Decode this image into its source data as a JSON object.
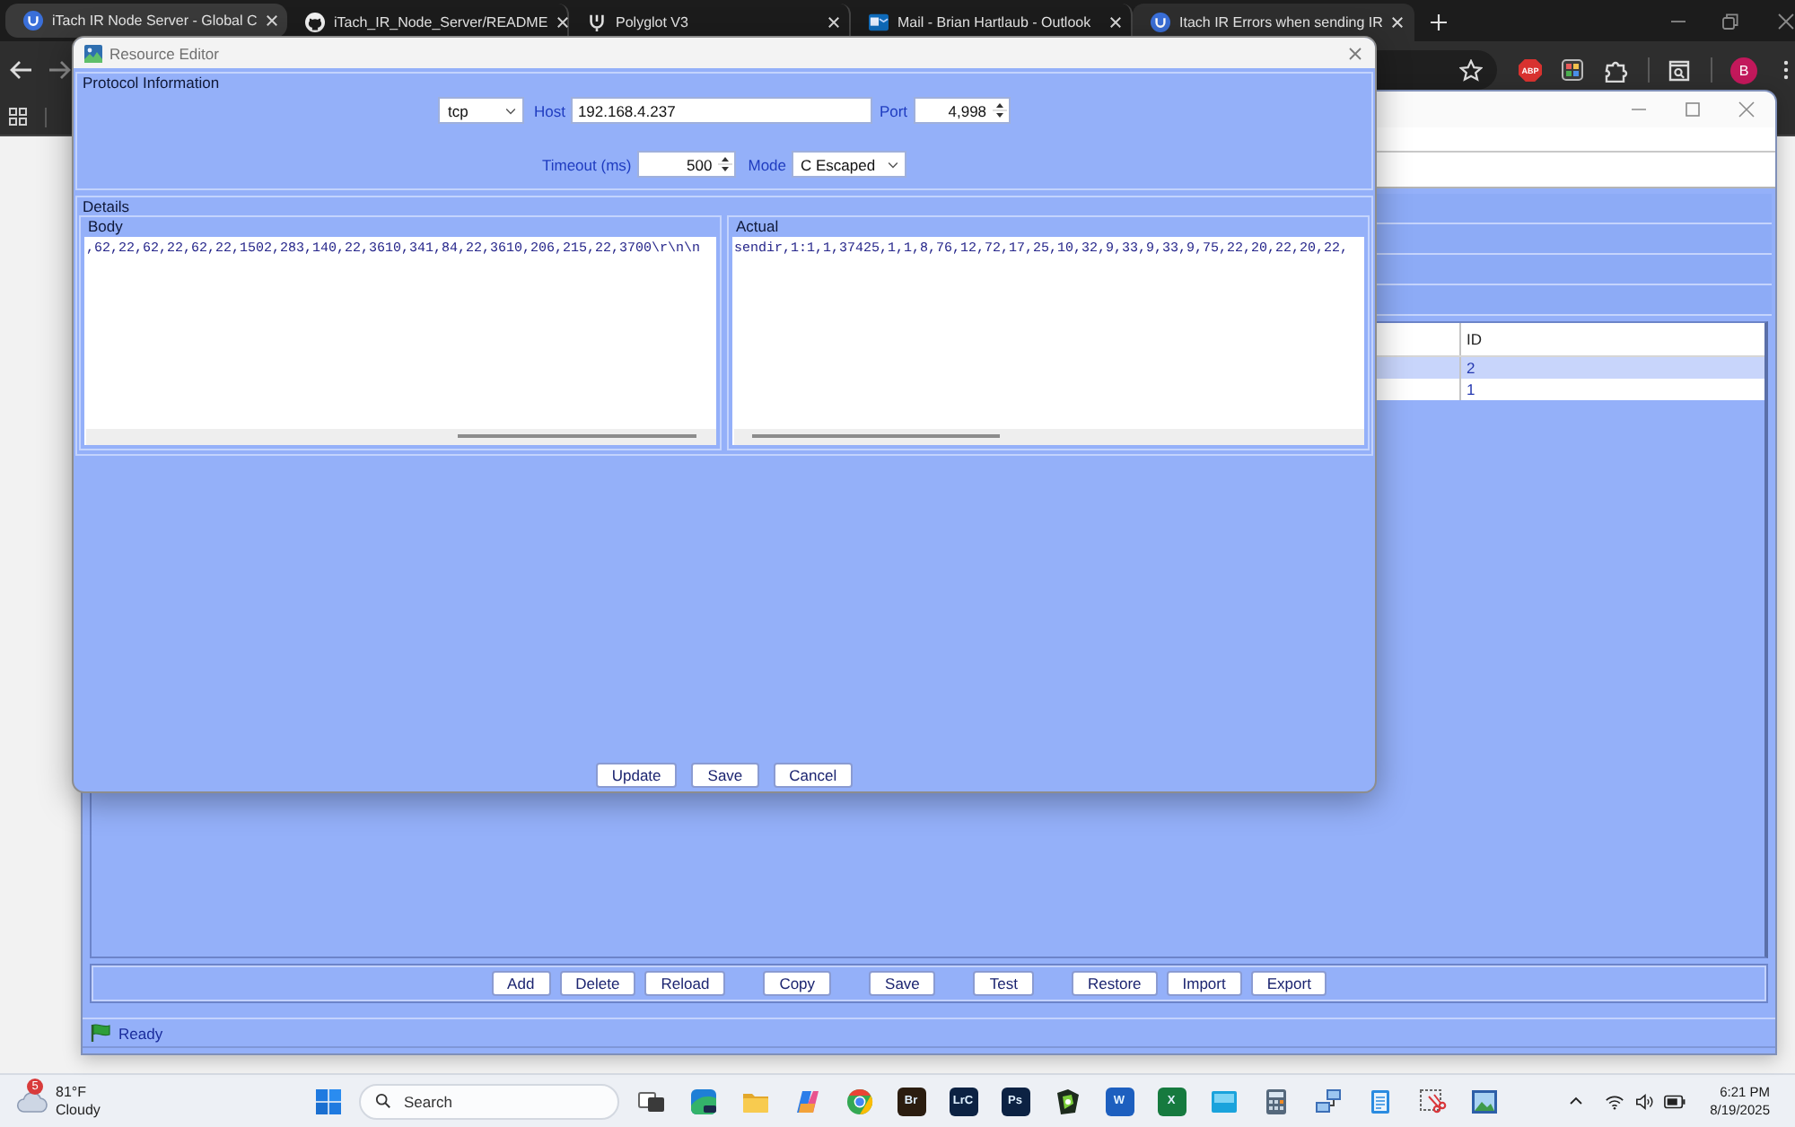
{
  "browser": {
    "tabs": [
      {
        "title": "iTach IR Node Server - Global C",
        "kind": "disc",
        "hovered": true,
        "selected": false
      },
      {
        "title": "iTach_IR_Node_Server/README",
        "kind": "cat",
        "hovered": false,
        "selected": false
      },
      {
        "title": "Polyglot V3",
        "kind": "glyph",
        "hovered": false,
        "selected": false
      },
      {
        "title": "Mail - Brian Hartlaub - Outlook",
        "kind": "mail",
        "hovered": false,
        "selected": false
      },
      {
        "title": "Itach IR Errors when sending IR",
        "kind": "disc",
        "hovered": false,
        "selected": true
      }
    ],
    "extensions": [
      {
        "kind": "badge",
        "label": "ABP"
      },
      {
        "kind": "palette"
      },
      {
        "kind": "puzzle"
      }
    ],
    "profile": {
      "initial": "B"
    }
  },
  "main_window": {
    "table": {
      "columns": [
        {
          "label": "ID"
        }
      ],
      "rows": [
        {
          "cells": [
            "2"
          ],
          "selected": true
        },
        {
          "cells": [
            "1"
          ],
          "selected": false
        }
      ]
    },
    "button_groups": [
      [
        "Add",
        "Delete",
        "Reload"
      ],
      [
        "Copy"
      ],
      [
        "Save"
      ],
      [
        "Test"
      ],
      [
        "Restore",
        "Import",
        "Export"
      ]
    ],
    "status": "Ready"
  },
  "dialog": {
    "title": "Resource Editor",
    "protocol": {
      "title": "Protocol Information",
      "protocol": "tcp",
      "host_label": "Host",
      "host": "192.168.4.237",
      "port_label": "Port",
      "port": "4,998",
      "timeout_label": "Timeout (ms)",
      "timeout": "500",
      "mode_label": "Mode",
      "mode": "C Escaped"
    },
    "details": {
      "title": "Details",
      "panes": [
        {
          "title": "Body",
          "text": ",62,22,62,22,62,22,1502,283,140,22,3610,341,84,22,3610,206,215,22,3700\\r\\n\\n"
        },
        {
          "title": "Actual",
          "text": "sendir,1:1,1,37425,1,1,8,76,12,72,17,25,10,32,9,33,9,33,9,75,22,20,22,20,22,"
        }
      ]
    },
    "buttons": [
      "Update",
      "Save",
      "Cancel"
    ]
  },
  "taskbar": {
    "weather": {
      "badge": "5",
      "temperature": "81°F",
      "condition": "Cloudy"
    },
    "search": {
      "label": "Search"
    },
    "apps": [
      {
        "kind": "taskview"
      },
      {
        "kind": "preview"
      },
      {
        "kind": "folder"
      },
      {
        "kind": "copilot"
      },
      {
        "kind": "chrome"
      },
      {
        "kind": "tile",
        "label": "Br",
        "color": "#2b1d10"
      },
      {
        "kind": "tile",
        "label": "LrC",
        "color": "#0c2243"
      },
      {
        "kind": "tile",
        "label": "Ps",
        "color": "#0c2243"
      },
      {
        "kind": "app"
      },
      {
        "kind": "tile",
        "label": "W",
        "color": "#1d5fbf"
      },
      {
        "kind": "tile",
        "label": "X",
        "color": "#167a3f"
      },
      {
        "kind": "screen"
      },
      {
        "kind": "calculator"
      },
      {
        "kind": "network"
      },
      {
        "kind": "notepad"
      },
      {
        "kind": "snip"
      },
      {
        "kind": "picture"
      }
    ],
    "clock": {
      "time": "6:21 PM",
      "date": "8/19/2025"
    }
  }
}
